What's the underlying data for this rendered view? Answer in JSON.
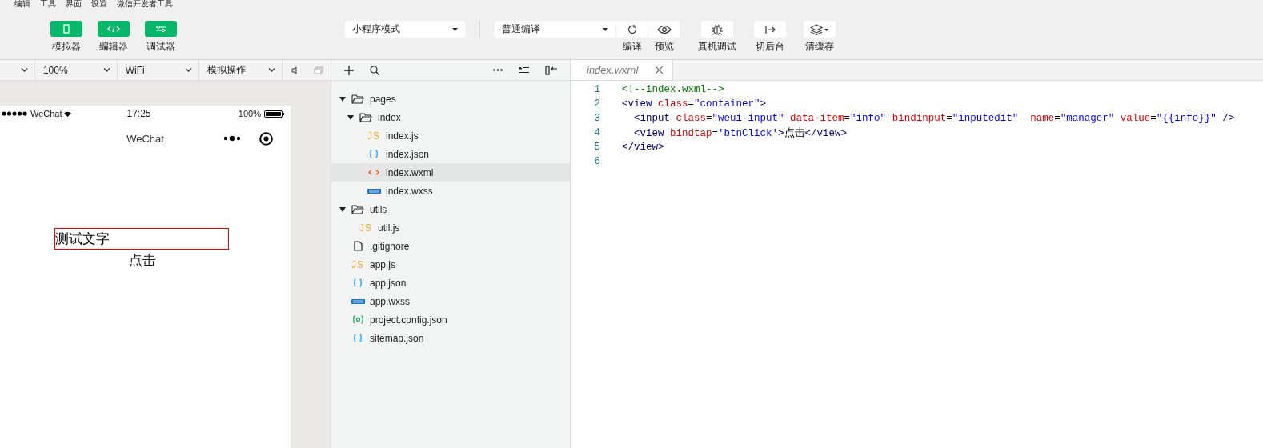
{
  "menu": [
    "编辑",
    "工具",
    "界面",
    "设置",
    "微信开发者工具"
  ],
  "toolbar": {
    "toggles": [
      {
        "label": "模拟器",
        "kind": "phone",
        "on": true
      },
      {
        "label": "编辑器",
        "kind": "code",
        "on": true
      },
      {
        "label": "调试器",
        "kind": "sliders",
        "on": true
      }
    ],
    "mode_select": "小程序模式",
    "compile_select": "普通编译",
    "actions": [
      {
        "label": "编译",
        "kind": "refresh",
        "grouped": true
      },
      {
        "label": "预览",
        "kind": "eye",
        "grouped": true
      },
      {
        "label": "真机调试",
        "kind": "bug",
        "grouped": false
      },
      {
        "label": "切后台",
        "kind": "exit",
        "grouped": false
      },
      {
        "label": "清缓存",
        "kind": "layers",
        "grouped": false
      }
    ]
  },
  "simulator_bar": {
    "selects": [
      "100%",
      "WiFi",
      "模拟操作"
    ]
  },
  "phone": {
    "carrier": "WeChat",
    "time": "17:25",
    "battery": "100%",
    "title": "WeChat",
    "input_value": "测试文字",
    "tap_text": "点击"
  },
  "file_tree": [
    {
      "name": "pages",
      "kind": "folder",
      "expanded": true,
      "children": [
        {
          "name": "index",
          "kind": "folder",
          "expanded": true,
          "children": [
            {
              "name": "index.js",
              "kind": "js",
              "badge": "JS",
              "selected": false
            },
            {
              "name": "index.json",
              "kind": "json",
              "selected": false
            },
            {
              "name": "index.wxml",
              "kind": "wxml",
              "selected": true
            },
            {
              "name": "index.wxss",
              "kind": "wxss",
              "selected": false
            }
          ]
        }
      ]
    },
    {
      "name": "utils",
      "kind": "folder",
      "expanded": true,
      "children": [
        {
          "name": "util.js",
          "kind": "js",
          "badge": "JS",
          "selected": false
        }
      ]
    },
    {
      "name": ".gitignore",
      "kind": "file",
      "selected": false
    },
    {
      "name": "app.js",
      "kind": "js",
      "badge": "JS",
      "selected": false
    },
    {
      "name": "app.json",
      "kind": "json",
      "selected": false
    },
    {
      "name": "app.wxss",
      "kind": "wxss",
      "selected": false
    },
    {
      "name": "project.config.json",
      "kind": "config",
      "selected": false
    },
    {
      "name": "sitemap.json",
      "kind": "json",
      "selected": false
    }
  ],
  "editor": {
    "tabs": [
      {
        "label": "index.wxml",
        "selected": true
      }
    ],
    "lines": [
      {
        "number": "1",
        "tokens": [
          {
            "kind": "comment",
            "text": "<!--index.wxml-->"
          }
        ]
      },
      {
        "number": "2",
        "tokens": [
          {
            "kind": "tag",
            "text": "<view "
          },
          {
            "kind": "attr",
            "text": "class"
          },
          {
            "kind": "plain",
            "text": "="
          },
          {
            "kind": "string",
            "text": "\"container\""
          },
          {
            "kind": "tag",
            "text": ">"
          }
        ]
      },
      {
        "number": "3",
        "tokens": [
          {
            "kind": "tag",
            "text": "  <input "
          },
          {
            "kind": "attr",
            "text": "class"
          },
          {
            "kind": "plain",
            "text": "="
          },
          {
            "kind": "string",
            "text": "\"weui-input\" "
          },
          {
            "kind": "attr",
            "text": "data-item"
          },
          {
            "kind": "plain",
            "text": "="
          },
          {
            "kind": "string",
            "text": "\"info\" "
          },
          {
            "kind": "attr",
            "text": "bindinput"
          },
          {
            "kind": "plain",
            "text": "="
          },
          {
            "kind": "string",
            "text": "\"inputedit\"  "
          },
          {
            "kind": "attr",
            "text": "name"
          },
          {
            "kind": "plain",
            "text": "="
          },
          {
            "kind": "string",
            "text": "\"manager\" "
          },
          {
            "kind": "attr",
            "text": "value"
          },
          {
            "kind": "plain",
            "text": "="
          },
          {
            "kind": "string",
            "text": "\"{{info}}\" "
          },
          {
            "kind": "tag",
            "text": "/>"
          }
        ]
      },
      {
        "number": "4",
        "tokens": [
          {
            "kind": "tag",
            "text": "  <view "
          },
          {
            "kind": "attr",
            "text": "bindtap"
          },
          {
            "kind": "plain",
            "text": "="
          },
          {
            "kind": "string",
            "text": "'btnClick'"
          },
          {
            "kind": "tag",
            "text": ">"
          },
          {
            "kind": "plain",
            "text": "点击"
          },
          {
            "kind": "tag",
            "text": "</view>"
          }
        ]
      },
      {
        "number": "5",
        "tokens": [
          {
            "kind": "tag",
            "text": "</view>"
          }
        ]
      },
      {
        "number": "6"
      }
    ]
  }
}
